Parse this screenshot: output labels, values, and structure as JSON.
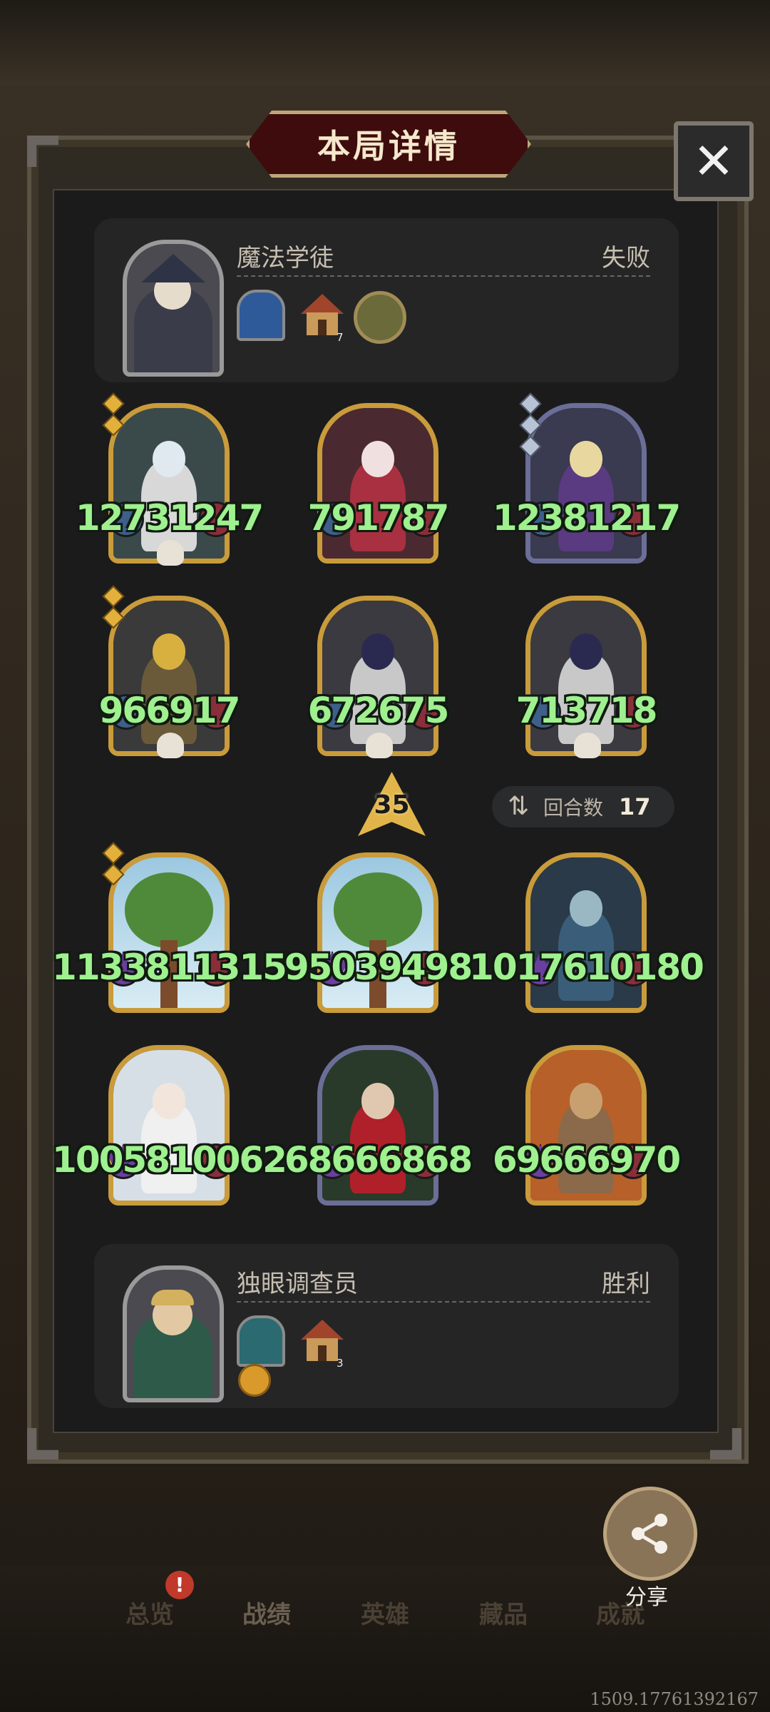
{
  "title": "本局详情",
  "close_label": "✕",
  "opponent": {
    "name": "魔法学徒",
    "result": "失败",
    "house_count": "7"
  },
  "player": {
    "name": "独眼调查员",
    "result": "胜利",
    "house_count": "3"
  },
  "opponent_units": [
    {
      "name": "robot-unit",
      "left": "1273",
      "right": "1247",
      "frame": "gold"
    },
    {
      "name": "clown-unit",
      "left": "791",
      "right": "787",
      "frame": "gold"
    },
    {
      "name": "mechanical-unit",
      "left": "1238",
      "right": "1217",
      "frame": "purple"
    },
    {
      "name": "golem-unit",
      "left": "966",
      "right": "917",
      "frame": "gold"
    },
    {
      "name": "bomb-knight-unit-1",
      "left": "672",
      "right": "675",
      "frame": "gold"
    },
    {
      "name": "bomb-knight-unit-2",
      "left": "713",
      "right": "718",
      "frame": "gold"
    }
  ],
  "player_units": [
    {
      "name": "tree-unit-1",
      "left": "11338",
      "right": "11315",
      "frame": "gold"
    },
    {
      "name": "tree-unit-2",
      "left": "9503",
      "right": "9498",
      "frame": "gold"
    },
    {
      "name": "elf-sorceress-unit",
      "left": "10176",
      "right": "10180",
      "frame": "gold"
    },
    {
      "name": "flower-girl-unit",
      "left": "10058",
      "right": "10062",
      "frame": "gold"
    },
    {
      "name": "elf-warrior-unit",
      "left": "6866",
      "right": "6868",
      "frame": "purple"
    },
    {
      "name": "treant-unit",
      "left": "6966",
      "right": "6970",
      "frame": "gold"
    }
  ],
  "level": "35",
  "rounds": {
    "label": "回合数",
    "value": "17"
  },
  "share_label": "分享",
  "nav": {
    "overview": "总览",
    "record": "战绩",
    "heroes": "英雄",
    "collection": "藏品",
    "achievements": "成就",
    "alert": "!"
  },
  "debug_text": "1509.17761392167"
}
